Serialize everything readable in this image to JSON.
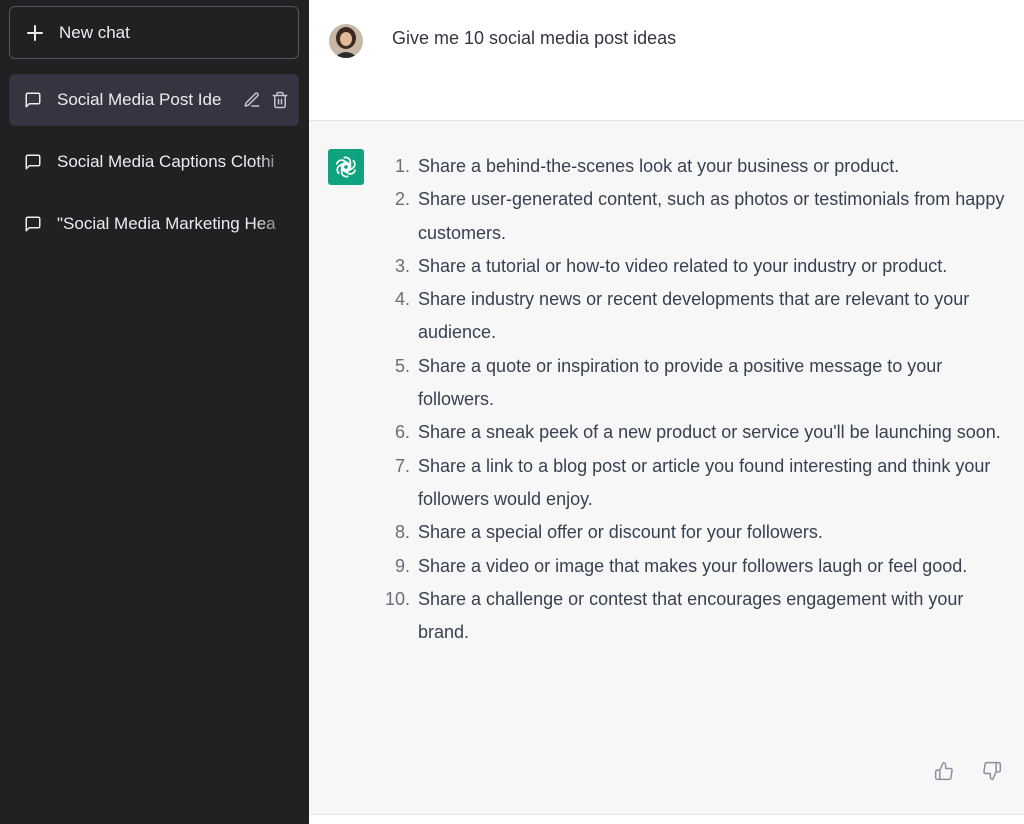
{
  "sidebar": {
    "new_chat_label": "New chat",
    "items": [
      {
        "label": "Social Media Post Ide",
        "active": true
      },
      {
        "label": "Social Media Captions Clothi",
        "active": false
      },
      {
        "label": "\"Social Media Marketing Hea",
        "active": false
      }
    ]
  },
  "user_message": {
    "text": "Give me 10 social media post ideas"
  },
  "assistant_message": {
    "items": [
      {
        "num": "1.",
        "text": "Share a behind-the-scenes look at your business or product."
      },
      {
        "num": "2.",
        "text": "Share user-generated content, such as photos or testimonials from happy customers."
      },
      {
        "num": "3.",
        "text": "Share a tutorial or how-to video related to your industry or product."
      },
      {
        "num": "4.",
        "text": "Share industry news or recent developments that are relevant to your audience."
      },
      {
        "num": "5.",
        "text": "Share a quote or inspiration to provide a positive message to your followers."
      },
      {
        "num": "6.",
        "text": "Share a sneak peek of a new product or service you'll be launching soon."
      },
      {
        "num": "7.",
        "text": "Share a link to a blog post or article you found interesting and think your followers would enjoy."
      },
      {
        "num": "8.",
        "text": "Share a special offer or discount for your followers."
      },
      {
        "num": "9.",
        "text": "Share a video or image that makes your followers laugh or feel good."
      },
      {
        "num": "10.",
        "text": "Share a challenge or contest that encourages engagement with your brand."
      }
    ]
  },
  "icons": {
    "new_chat": "plus-icon",
    "chat_item": "message-square-icon",
    "edit": "pencil-icon",
    "delete": "trash-icon",
    "assistant": "openai-logo-icon",
    "like": "thumbs-up-icon",
    "dislike": "thumbs-down-icon"
  },
  "colors": {
    "sidebar_bg": "#202123",
    "active_item_bg": "#343541",
    "assistant_row_bg": "#f7f7f8",
    "brand_green": "#10a37f"
  }
}
